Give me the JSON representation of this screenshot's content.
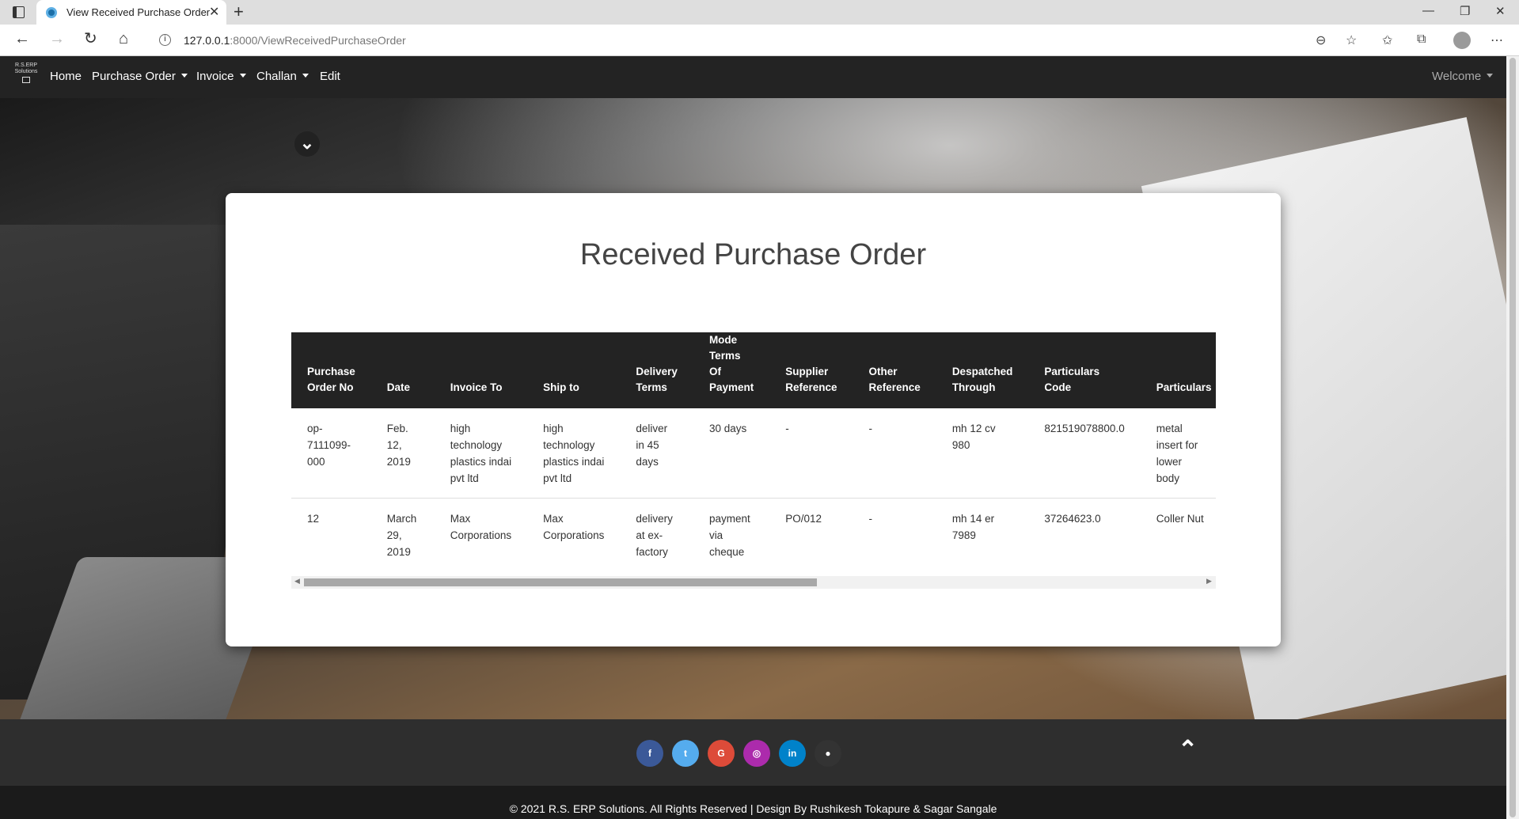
{
  "browser": {
    "tab_title": "View Received Purchase Order",
    "url_host": "127.0.0.1",
    "url_path": ":8000/ViewReceivedPurchaseOrder"
  },
  "navbar": {
    "brand_line1": "R.S.ERP",
    "brand_line2": "Solutions",
    "items": [
      {
        "label": "Home"
      },
      {
        "label": "Purchase Order"
      },
      {
        "label": "Invoice"
      },
      {
        "label": "Challan"
      },
      {
        "label": "Edit"
      }
    ],
    "welcome": "Welcome"
  },
  "page": {
    "title": "Received Purchase Order"
  },
  "table": {
    "headers": [
      [
        "Purchase",
        "Order No"
      ],
      [
        "Date"
      ],
      [
        "Invoice To"
      ],
      [
        "Ship to"
      ],
      [
        "Delivery",
        "Terms"
      ],
      [
        "Mode",
        "Terms Of",
        "Payment"
      ],
      [
        "Supplier",
        "Reference"
      ],
      [
        "Other",
        "Reference"
      ],
      [
        "Despatched",
        "Through"
      ],
      [
        "Particulars Code"
      ],
      [
        "Particulars"
      ]
    ],
    "rows": [
      [
        [
          "op-",
          "7111099-",
          "000"
        ],
        [
          "Feb.",
          "12,",
          "2019"
        ],
        [
          "high",
          "technology",
          "plastics indai",
          "pvt ltd"
        ],
        [
          "high",
          "technology",
          "plastics indai",
          "pvt ltd"
        ],
        [
          "deliver",
          "in 45",
          "days"
        ],
        [
          "30 days"
        ],
        [
          "-"
        ],
        [
          "-"
        ],
        [
          "mh 12 cv",
          "980"
        ],
        [
          "821519078800.0"
        ],
        [
          "metal",
          "insert for",
          "lower",
          "body"
        ]
      ],
      [
        [
          "12"
        ],
        [
          "March",
          "29,",
          "2019"
        ],
        [
          "Max",
          "Corporations"
        ],
        [
          "Max",
          "Corporations"
        ],
        [
          "delivery",
          "at ex-",
          "factory"
        ],
        [
          "payment",
          "via",
          "cheque"
        ],
        [
          "PO/012"
        ],
        [
          "-"
        ],
        [
          "mh 14 er",
          "7989"
        ],
        [
          "37264623.0"
        ],
        [
          "Coller Nut"
        ]
      ]
    ]
  },
  "footer": {
    "social": [
      {
        "icon": "facebook-icon",
        "glyph": "f",
        "color": "#3b5998"
      },
      {
        "icon": "twitter-icon",
        "glyph": "t",
        "color": "#55acee"
      },
      {
        "icon": "google-icon",
        "glyph": "G",
        "color": "#dd4b39"
      },
      {
        "icon": "instagram-icon",
        "glyph": "◎",
        "color": "#ac2bac"
      },
      {
        "icon": "linkedin-icon",
        "glyph": "in",
        "color": "#0082ca"
      },
      {
        "icon": "github-icon",
        "glyph": "●",
        "color": "#333333"
      }
    ],
    "copyright": "© 2021 R.S. ERP Solutions. All Rights Reserved | Design By Rushikesh Tokapure & Sagar Sangale"
  }
}
